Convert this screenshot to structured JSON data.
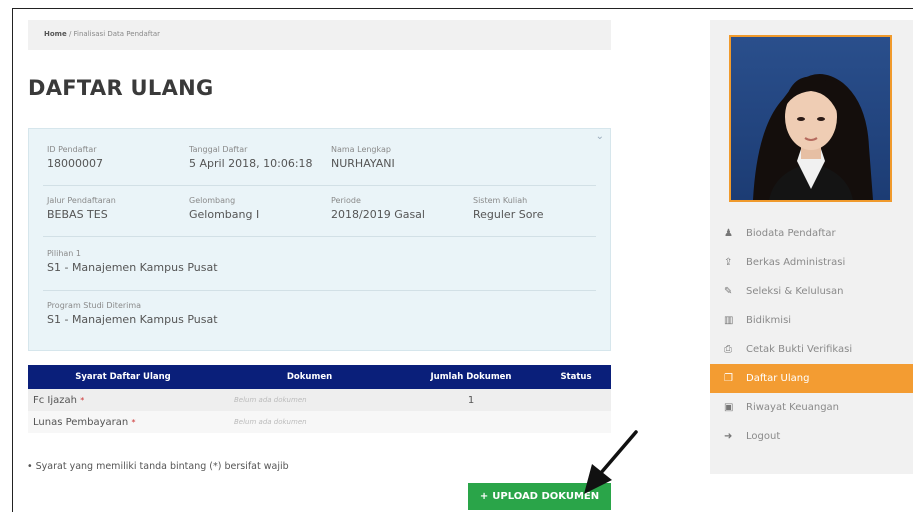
{
  "breadcrumb": {
    "home": "Home",
    "sep": " / ",
    "current": "Finalisasi Data Pendaftar"
  },
  "page_title": "DAFTAR ULANG",
  "info": {
    "id_pendaftar": {
      "label": "ID Pendaftar",
      "value": "18000007"
    },
    "tanggal_daftar": {
      "label": "Tanggal Daftar",
      "value": "5 April 2018, 10:06:18"
    },
    "nama_lengkap": {
      "label": "Nama Lengkap",
      "value": "NURHAYANI"
    },
    "jalur_pendaftaran": {
      "label": "Jalur Pendaftaran",
      "value": "BEBAS TES"
    },
    "gelombang": {
      "label": "Gelombang",
      "value": "Gelombang I"
    },
    "periode": {
      "label": "Periode",
      "value": "2018/2019 Gasal"
    },
    "sistem_kuliah": {
      "label": "Sistem Kuliah",
      "value": "Reguler Sore"
    },
    "pilihan_1": {
      "label": "Pilihan 1",
      "value": "S1 - Manajemen Kampus Pusat"
    },
    "program_studi": {
      "label": "Program Studi Diterima",
      "value": "S1 - Manajemen Kampus Pusat"
    }
  },
  "table": {
    "headers": [
      "Syarat Daftar Ulang",
      "Dokumen",
      "Jumlah Dokumen",
      "Status"
    ],
    "rows": [
      {
        "name": "Fc Ijazah",
        "star": "*",
        "document": "Belum ada dokumen",
        "count": "1",
        "status": ""
      },
      {
        "name": "Lunas Pembayaran",
        "star": "*",
        "document": "Belum ada dokumen",
        "count": "",
        "status": ""
      }
    ]
  },
  "note": "Syarat yang memiliki tanda bintang (*) bersifat wajib",
  "upload_button": {
    "icon": "+",
    "label": "UPLOAD DOKUMEN"
  },
  "sidebar": {
    "menu": [
      {
        "icon": "user-icon",
        "glyph": "♟",
        "label": "Biodata Pendaftar",
        "active": false
      },
      {
        "icon": "upload-icon",
        "glyph": "⇪",
        "label": "Berkas Administrasi",
        "active": false
      },
      {
        "icon": "edit-icon",
        "glyph": "✎",
        "label": "Seleksi & Kelulusan",
        "active": false
      },
      {
        "icon": "bank-icon",
        "glyph": "▥",
        "label": "Bidikmisi",
        "active": false
      },
      {
        "icon": "print-icon",
        "glyph": "⎙",
        "label": "Cetak Bukti Verifikasi",
        "active": false
      },
      {
        "icon": "copy-icon",
        "glyph": "❐",
        "label": "Daftar Ulang",
        "active": true
      },
      {
        "icon": "money-icon",
        "glyph": "▣",
        "label": "Riwayat Keuangan",
        "active": false
      },
      {
        "icon": "logout-icon",
        "glyph": "➜",
        "label": "Logout",
        "active": false
      }
    ]
  },
  "colors": {
    "table_header": "#0a1f7a",
    "active_menu": "#f39c32",
    "upload_button": "#2aa549",
    "photo_border": "#f09a2c"
  }
}
